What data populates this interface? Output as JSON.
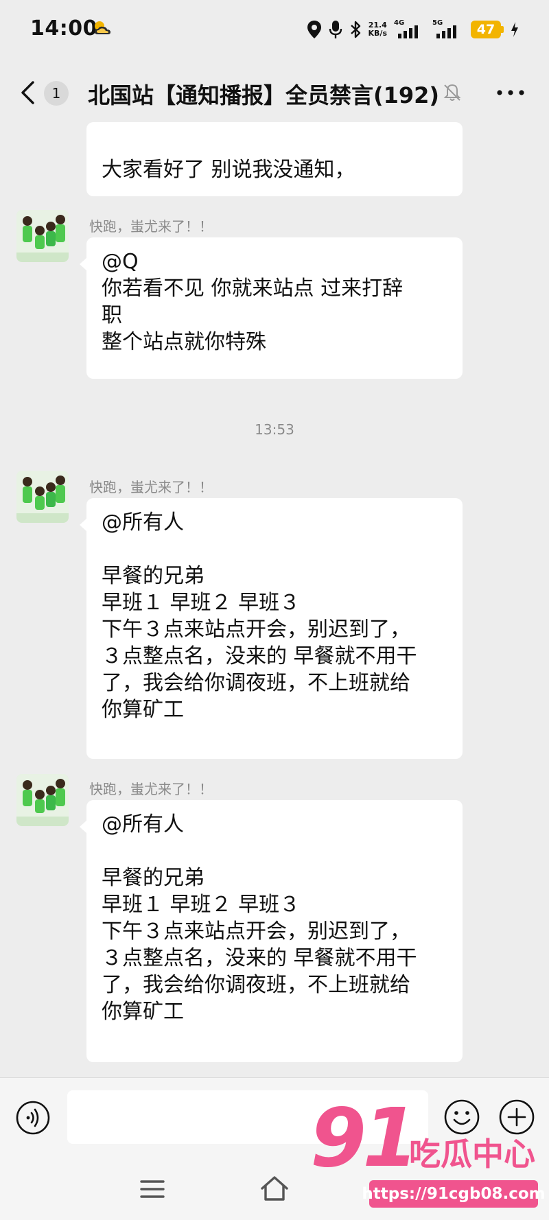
{
  "status_bar": {
    "time": "14:00",
    "net_speed_value": "21.4",
    "net_speed_unit": "KB/s",
    "sim1_label": "4G",
    "sim2_label": "5G",
    "battery": "47",
    "battery_color": "#f2b400"
  },
  "header": {
    "unread_count": "1",
    "title": "北国站【通知播报】全员禁言(192)"
  },
  "messages": [
    {
      "type": "partial",
      "text": "大家看好了 别说我没通知，"
    },
    {
      "type": "message",
      "sender": "快跑，蚩尤来了！！",
      "text": "@Q\n你若看不见 你就来站点 过来打辞\n职\n整个站点就你特殊"
    },
    {
      "type": "time",
      "text": "13:53"
    },
    {
      "type": "message",
      "sender": "快跑，蚩尤来了！！",
      "text": "@所有人\n\n早餐的兄弟\n早班１ 早班２ 早班３\n下午３点来站点开会，别迟到了，\n３点整点名，没来的 早餐就不用干\n了，我会给你调夜班，不上班就给\n你算矿工"
    },
    {
      "type": "message",
      "sender": "快跑，蚩尤来了！！",
      "text": "@所有人\n\n早餐的兄弟\n早班１ 早班２ 早班３\n下午３点来站点开会，别迟到了，\n３点整点名，没来的 早餐就不用干\n了，我会给你调夜班，不上班就给\n你算矿工"
    }
  ],
  "input": {
    "value": "",
    "placeholder": ""
  },
  "watermark": {
    "number": "91",
    "brand": "吃瓜中心",
    "url": "https://91cgb08.com",
    "color": "#f0548e"
  }
}
